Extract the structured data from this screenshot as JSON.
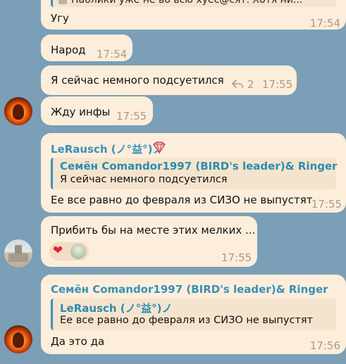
{
  "messages": [
    {
      "quote_text": "Паблики уже не во всю хуес@сят. Хотя ни...",
      "text": "Угу",
      "time": "17:54"
    },
    {
      "text": "Народ",
      "time": "17:54"
    },
    {
      "text": "Я сейчас немного подсуетился",
      "replies": "2",
      "time": "17:55"
    },
    {
      "text": "Жду инфы",
      "time": "17:55"
    },
    {
      "sender": "LeRausch (ノ°益°)ノ",
      "badge": "sticker-icon",
      "quote_sender": "Семён Comandor1997 (BIRD's leader)& Ringer",
      "quote_text": "Я сейчас немного подсуетился",
      "text": "Ее все равно до февраля из СИЗО не выпустят",
      "time": "17:55"
    },
    {
      "text": "Прибить бы на месте этих мелких ...",
      "reaction": "❤",
      "time": "17:55"
    },
    {
      "sender": "Семён Comandor1997 (BIRD's leader)& Ringer",
      "quote_sender": "LeRausch (ノ°益°)ノ",
      "quote_text": "Ее все равно до февраля из СИЗО не выпустят",
      "text": "Да это да",
      "time": "17:56"
    }
  ],
  "colors": {
    "background": "#7a9fb6",
    "bubble": "#fdeedb",
    "accent": "#2e8bb0"
  }
}
